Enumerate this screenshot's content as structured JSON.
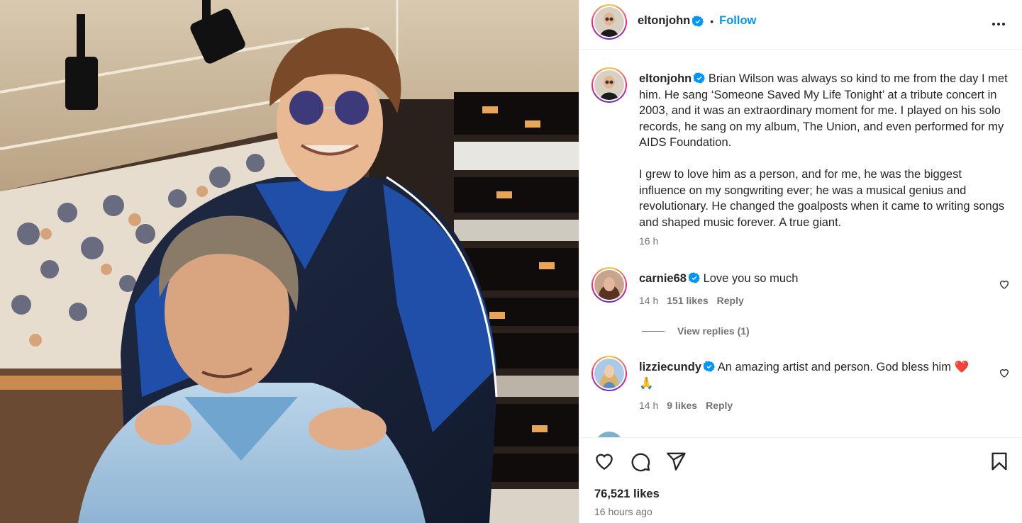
{
  "post": {
    "username": "eltonjohn",
    "follow_label": "Follow",
    "dot": "•",
    "caption": "Brian Wilson was always so kind to me from the day I met him. He sang ‘Someone Saved My Life Tonight’ at a tribute concert in 2003, and it was an extraordinary moment for me. I played on his solo records, he sang on my album, The Union, and even performed for my AIDS Foundation.\n\nI grew to love him as a person, and for me, he was the biggest influence on my songwriting ever; he was a musical genius and revolutionary. He changed the goalposts when it came to writing songs and shaped music forever. A true giant.",
    "caption_time": "16 h",
    "likes": "76,521 likes",
    "posted": "16 hours ago"
  },
  "comments": [
    {
      "username": "carnie68",
      "text": "Love you so much",
      "time": "14 h",
      "likes": "151 likes",
      "reply": "Reply",
      "view_replies": "View replies (1)"
    },
    {
      "username": "lizziecundy",
      "text": "An amazing artist and person. God bless him ❤️ 🙏",
      "time": "14 h",
      "likes": "9 likes",
      "reply": "Reply"
    }
  ],
  "icons": {
    "more": "more-options-icon",
    "verified": "verified-badge-icon",
    "like": "heart-icon",
    "comment": "comment-icon",
    "share": "share-icon",
    "save": "bookmark-icon"
  },
  "colors": {
    "accent": "#0095f6",
    "text": "#262626",
    "muted": "#737373",
    "verified": "#0095f6"
  }
}
